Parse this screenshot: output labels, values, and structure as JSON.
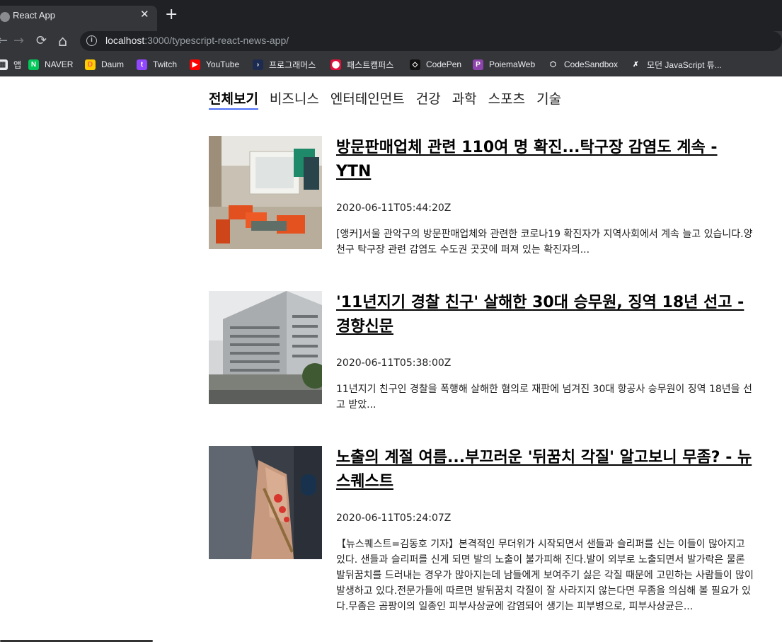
{
  "browser": {
    "tab_title": "React App",
    "tab_close": "✕",
    "new_tab": "+",
    "back": "←",
    "forward": "→",
    "reload": "⟳",
    "home": "⌂",
    "url_host": "localhost",
    "url_rest": ":3000/typescript-react-news-app/"
  },
  "bookmarks": [
    {
      "label": "앱",
      "icon": "apps-icon",
      "color": "#e8eaed",
      "glyph": "▦"
    },
    {
      "label": "NAVER",
      "icon": "naver-icon",
      "color": "#03c75a",
      "glyph": "N"
    },
    {
      "label": "Daum",
      "icon": "daum-icon",
      "color": "#ffcd00",
      "glyph": "D"
    },
    {
      "label": "Twitch",
      "icon": "twitch-icon",
      "color": "#9146ff",
      "glyph": "t"
    },
    {
      "label": "YouTube",
      "icon": "youtube-icon",
      "color": "#ff0000",
      "glyph": "▶"
    },
    {
      "label": "프로그래머스",
      "icon": "programmers-icon",
      "color": "#1e2b50",
      "glyph": "›"
    },
    {
      "label": "패스트캠퍼스",
      "icon": "fastcampus-icon",
      "color": "#e2103b",
      "glyph": "⬤"
    },
    {
      "label": "CodePen",
      "icon": "codepen-icon",
      "color": "#111111",
      "glyph": "◇"
    },
    {
      "label": "PoiemaWeb",
      "icon": "poiemaweb-icon",
      "color": "#8e44ad",
      "glyph": "P"
    },
    {
      "label": "CodeSandbox",
      "icon": "codesandbox-icon",
      "color": "#35363a",
      "glyph": "⬡"
    },
    {
      "label": "모던 JavaScript 튜...",
      "icon": "javascript-info-icon",
      "color": "#35363a",
      "glyph": "✗"
    }
  ],
  "categories": [
    "전체보기",
    "비즈니스",
    "엔터테인먼트",
    "건강",
    "과학",
    "스포츠",
    "기술"
  ],
  "active_category": "전체보기",
  "accent_color": "#4c6ef5",
  "articles": [
    {
      "title": "방문판매업체 관련 110여 명 확진...탁구장 감염도 계속 - YTN",
      "date": "2020-06-11T05:44:20Z",
      "description": "[앵커]서울 관악구의 방문판매업체와 관련한 코로나19 확진자가 지역사회에서 계속 늘고 있습니다.양천구 탁구장 관련 감염도 수도권 곳곳에 퍼져 있는 확진자의..."
    },
    {
      "title": "'11년지기 경찰 친구' 살해한 30대 승무원, 징역 18년 선고 - 경향신문",
      "date": "2020-06-11T05:38:00Z",
      "description": "11년지기 친구인 경찰을 폭행해 살해한 혐의로 재판에 넘겨진 30대 항공사 승무원이 징역 18년을 선고 받았..."
    },
    {
      "title": "노출의 계절 여름...부끄러운 '뒤꿈치 각질' 알고보니 무좀? - 뉴스퀘스트",
      "date": "2020-06-11T05:24:07Z",
      "description": "【뉴스퀘스트=김동호 기자】본격적인 무더위가 시작되면서 샌들과 슬리퍼를 신는 이들이 많아지고 있다. 샌들과 슬리퍼를 신게 되면 발의 노출이 불가피해 진다.발이 외부로 노출되면서 발가락은 물론 발뒤꿈치를 드러내는 경우가 많아지는데 남들에게 보여주기 싫은 각질 때문에 고민하는 사람들이 많이 발생하고 있다.전문가들에 따르면 발뒤꿈치 각질이 잘 사라지지 않는다면 무좀을 의심해 볼 필요가 있다.무좀은 곰팡이의 일종인 피부사상균에 감염되어 생기는 피부병으로, 피부사상균은..."
    }
  ]
}
